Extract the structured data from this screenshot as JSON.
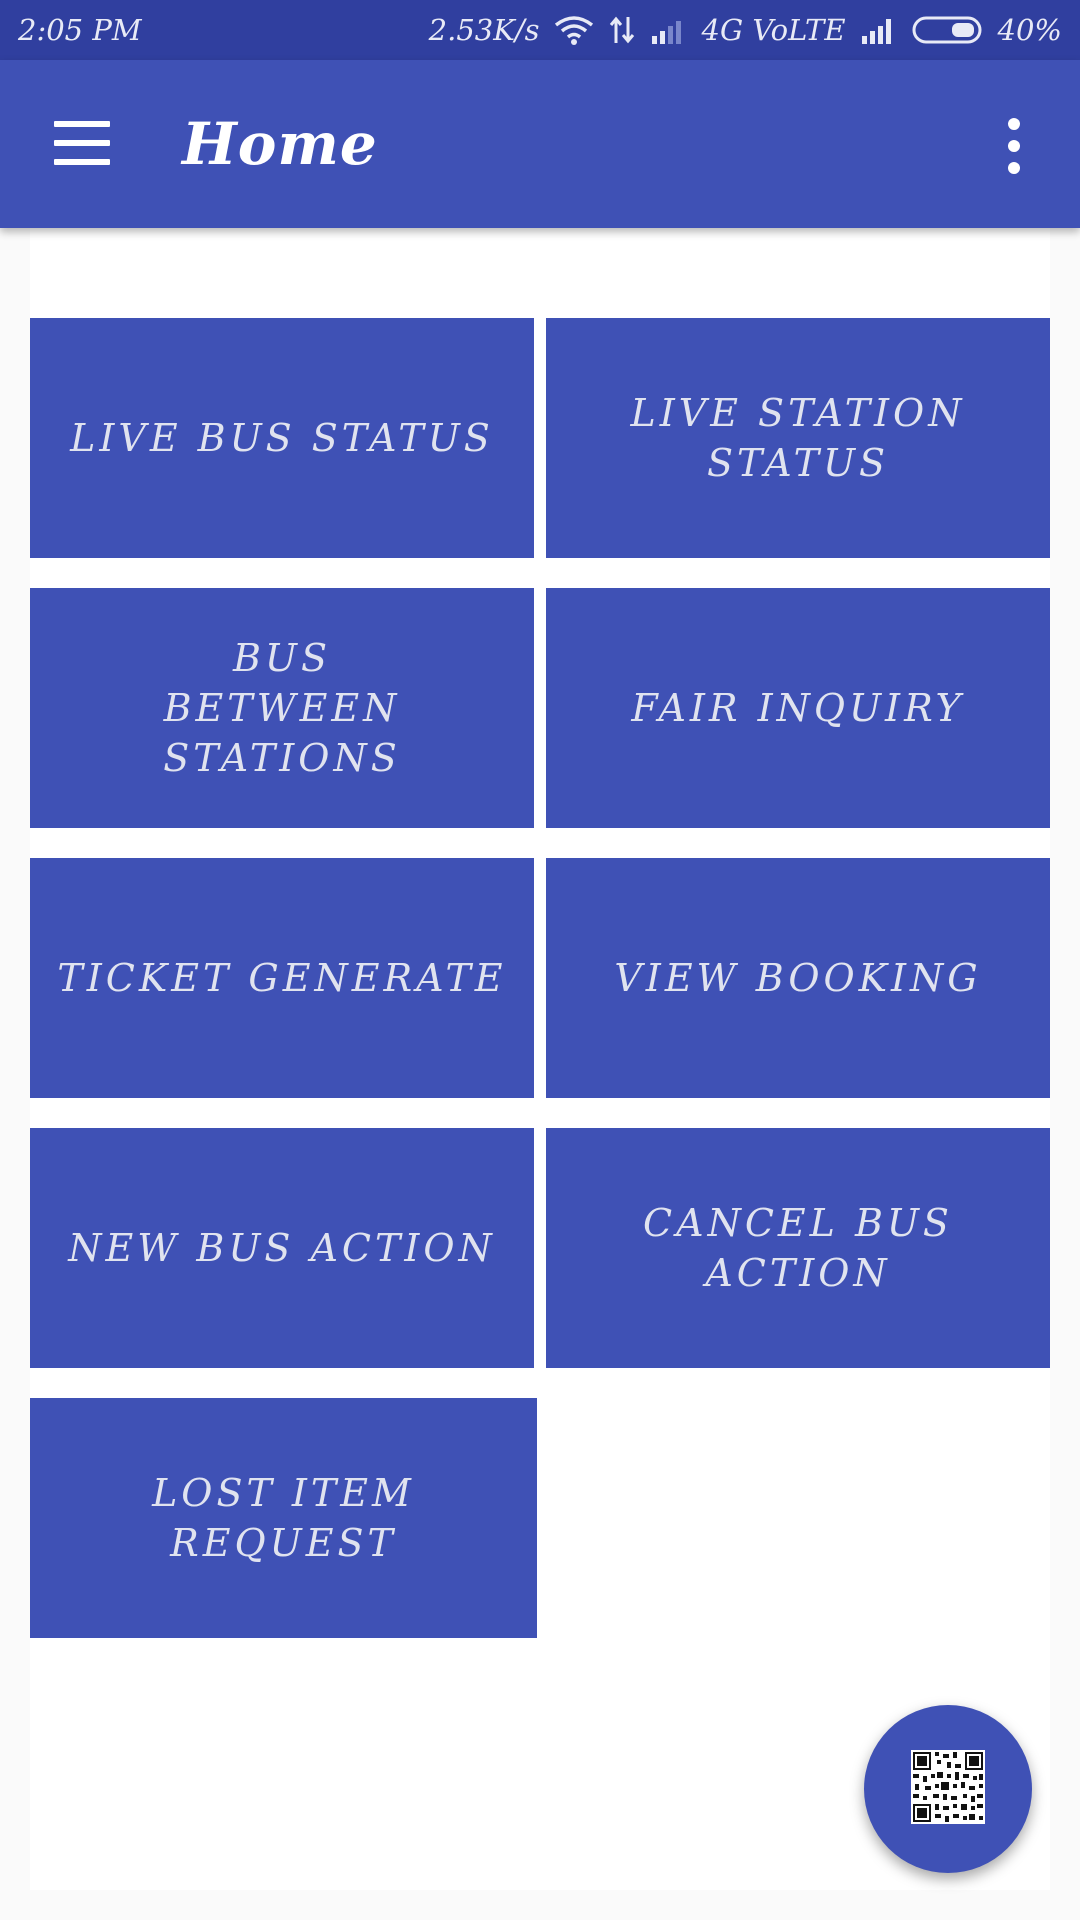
{
  "status_bar": {
    "time": "2:05 PM",
    "net_speed": "2.53K/s",
    "network": "4G VoLTE",
    "battery": "40%",
    "icons": [
      "wifi-icon",
      "data-transfer-icon",
      "signal-icon",
      "signal-icon",
      "battery-icon"
    ]
  },
  "app_bar": {
    "menu_icon": "hamburger-menu-icon",
    "title": "Home",
    "overflow_icon": "more-vertical-icon"
  },
  "tiles": [
    {
      "label": "LIVE BUS STATUS"
    },
    {
      "label": "LIVE STATION STATUS"
    },
    {
      "label": "BUS BETWEEN STATIONS"
    },
    {
      "label": "FAIR INQUIRY"
    },
    {
      "label": "TICKET GENERATE"
    },
    {
      "label": "VIEW BOOKING"
    },
    {
      "label": "NEW BUS ACTION"
    },
    {
      "label": "CANCEL BUS ACTION"
    },
    {
      "label": "LOST ITEM REQUEST"
    }
  ],
  "fab": {
    "icon": "qr-code-icon"
  },
  "colors": {
    "status_bar": "#303f9f",
    "primary": "#3f51b5",
    "tile_text": "#e0e3ef",
    "background": "#fafafa"
  }
}
